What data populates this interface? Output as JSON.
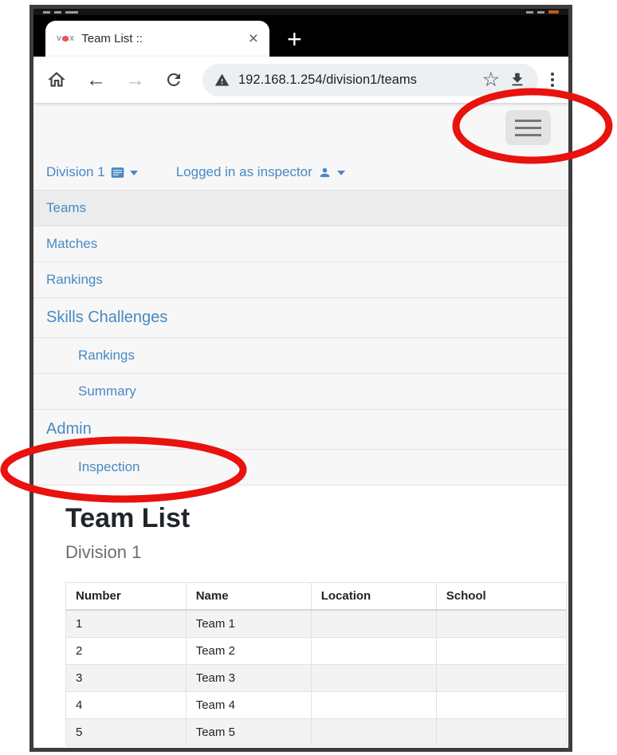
{
  "browser": {
    "tab": {
      "favicon": "vex-logo-icon",
      "title": "Team List ::",
      "close_glyph": "×",
      "new_tab_glyph": "+"
    },
    "toolbar": {
      "back_glyph": "←",
      "forward_glyph": "→",
      "url": "192.168.1.254/division1/teams",
      "star_glyph": "☆",
      "icons": {
        "home": "home-icon",
        "reload": "reload-icon",
        "site_warning": "warning-triangle-icon",
        "download": "download-icon",
        "menu": "kebab-menu-icon"
      }
    }
  },
  "page": {
    "menu_button": {
      "icon": "hamburger-icon"
    },
    "division_menu": {
      "label": "Division 1",
      "icon": "display-icon"
    },
    "user_menu": {
      "label": "Logged in as inspector",
      "icon": "person-icon"
    },
    "nav": {
      "items": [
        {
          "label": "Teams",
          "active": true
        },
        {
          "label": "Matches"
        },
        {
          "label": "Rankings"
        },
        {
          "label": "Skills Challenges",
          "size": "large"
        },
        {
          "label": "Rankings",
          "indent": true
        },
        {
          "label": "Summary",
          "indent": true
        },
        {
          "label": "Admin",
          "size": "large"
        },
        {
          "label": "Inspection",
          "indent": true
        }
      ]
    },
    "heading": "Team List",
    "subheading": "Division 1",
    "team_table": {
      "columns": [
        "Number",
        "Name",
        "Location",
        "School"
      ],
      "rows": [
        [
          "1",
          "Team 1",
          "",
          ""
        ],
        [
          "2",
          "Team 2",
          "",
          ""
        ],
        [
          "3",
          "Team 3",
          "",
          ""
        ],
        [
          "4",
          "Team 4",
          "",
          ""
        ],
        [
          "5",
          "Team 5",
          "",
          ""
        ]
      ]
    }
  },
  "annotations": {
    "highlight_color": "#e8120e",
    "ellipses": [
      {
        "target": "menu-button",
        "cx": "668",
        "cy": "158",
        "rx": "96",
        "ry": "43"
      },
      {
        "target": "nav-item-inspection",
        "cx": "155",
        "cy": "589",
        "rx": "150",
        "ry": "37"
      }
    ]
  },
  "colors": {
    "link_blue": "#4789c4",
    "page_bg": "#f7f7f7",
    "active_row_bg": "#ececec"
  }
}
